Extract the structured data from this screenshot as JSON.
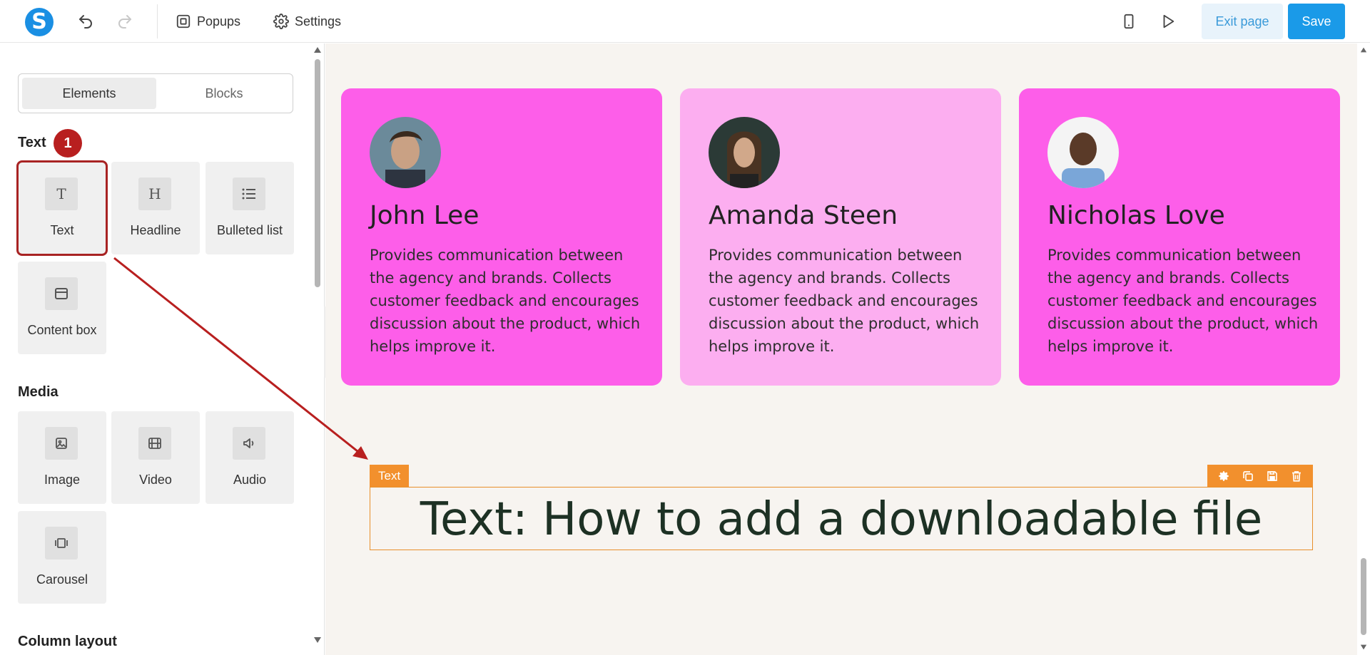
{
  "topbar": {
    "popups_label": "Popups",
    "settings_label": "Settings",
    "exit_label": "Exit page",
    "save_label": "Save",
    "logo_letter": "S"
  },
  "sidebar": {
    "tabs": [
      "Elements",
      "Blocks"
    ],
    "sections": [
      {
        "title": "Text",
        "items": [
          "Text",
          "Headline",
          "Bulleted list",
          "Content box"
        ]
      },
      {
        "title": "Media",
        "items": [
          "Image",
          "Video",
          "Audio",
          "Carousel"
        ]
      },
      {
        "title": "Column layout"
      }
    ],
    "step_badge": "1"
  },
  "canvas": {
    "cards": [
      {
        "name": "John Lee",
        "desc": "Provides communication between the agency and brands. Collects customer feedback and encourages discussion about the product, which helps improve it.",
        "color": "#fd5ee9"
      },
      {
        "name": "Amanda Steen",
        "desc": "Provides communication between the agency and brands. Collects customer feedback and encourages discussion about the product, which helps improve it.",
        "color": "#fcaef0"
      },
      {
        "name": "Nicholas Love",
        "desc": "Provides communication between the agency and brands. Collects customer feedback and encourages discussion about the product, which helps improve it.",
        "color": "#fd5ee9"
      }
    ],
    "selected_tag": "Text",
    "headline": "Text: How to add a downloadable file"
  },
  "colors": {
    "accent": "#1a9ae8",
    "annotation": "#b81f1f",
    "selection": "#f2902d",
    "canvas_bg": "#f7f4f0"
  }
}
